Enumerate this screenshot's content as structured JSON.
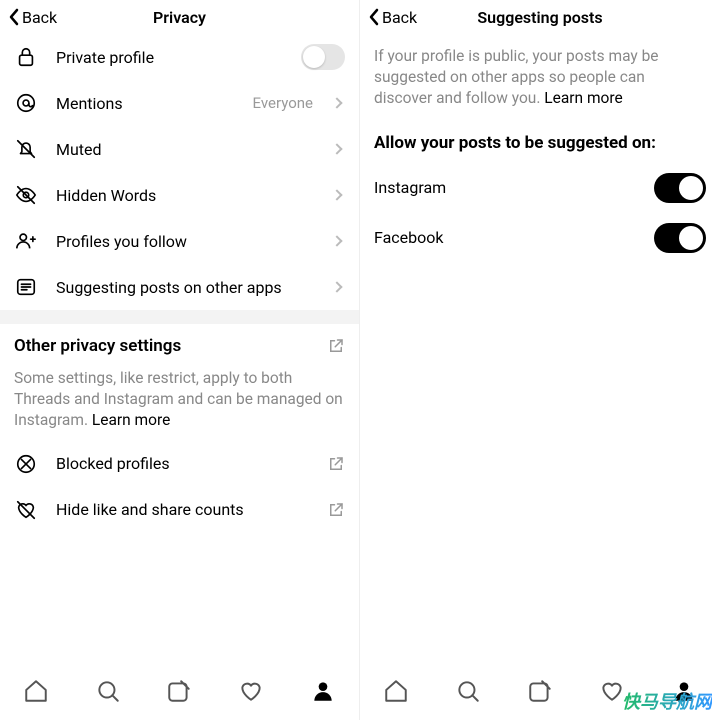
{
  "left": {
    "back": "Back",
    "title": "Privacy",
    "items": [
      {
        "icon": "lock",
        "label": "Private profile",
        "ctrl": "toggle-off"
      },
      {
        "icon": "at",
        "label": "Mentions",
        "value": "Everyone",
        "ctrl": "chev"
      },
      {
        "icon": "bell-off",
        "label": "Muted",
        "ctrl": "chev"
      },
      {
        "icon": "eye-off",
        "label": "Hidden Words",
        "ctrl": "chev"
      },
      {
        "icon": "people",
        "label": "Profiles you follow",
        "ctrl": "chev"
      },
      {
        "icon": "list",
        "label": "Suggesting posts on other apps",
        "ctrl": "chev"
      }
    ],
    "otherHeading": "Other privacy settings",
    "otherText": "Some settings, like restrict, apply to both Threads and Instagram and can be managed on Instagram. ",
    "learnMore": "Learn more",
    "extra": [
      {
        "icon": "block",
        "label": "Blocked profiles"
      },
      {
        "icon": "heart-off",
        "label": "Hide like and share counts"
      }
    ]
  },
  "right": {
    "back": "Back",
    "title": "Suggesting posts",
    "intro": "If your profile is public, your posts may be suggested on other apps so people can discover and follow you. ",
    "learnMore": "Learn more",
    "allowTitle": "Allow your posts to be suggested on:",
    "toggles": [
      {
        "label": "Instagram",
        "on": true
      },
      {
        "label": "Facebook",
        "on": true
      }
    ]
  },
  "watermark": "快马导航网"
}
